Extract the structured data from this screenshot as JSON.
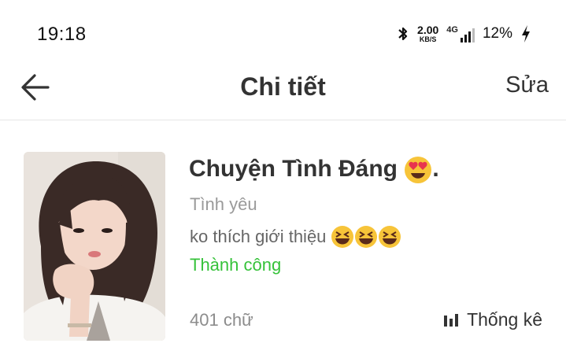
{
  "status_bar": {
    "time": "19:18",
    "speed_value": "2.00",
    "speed_unit": "KB/S",
    "network": "4G",
    "battery": "12%",
    "icons": [
      "bluetooth-icon",
      "signal-icon",
      "charging-bolt-icon"
    ]
  },
  "header": {
    "title": "Chi tiết",
    "edit_label": "Sửa",
    "back_icon": "arrow-left-icon"
  },
  "story": {
    "title": "Chuyện Tình Đáng",
    "title_emoji": "heart-eyes-emoji",
    "title_suffix": ".",
    "genre": "Tình yêu",
    "description": "ko thích giới thiệu",
    "description_emojis": [
      "laughing-emoji",
      "laughing-emoji",
      "laughing-emoji"
    ],
    "status": "Thành công",
    "word_count": "401 chữ",
    "stats_label": "Thống kê",
    "stats_icon": "bar-chart-icon"
  },
  "colors": {
    "status_green": "#36c23a",
    "title_text": "#333333",
    "muted_text": "#9a9a9a",
    "emoji_yellow": "#f7c439",
    "heart_red": "#e8344e"
  }
}
